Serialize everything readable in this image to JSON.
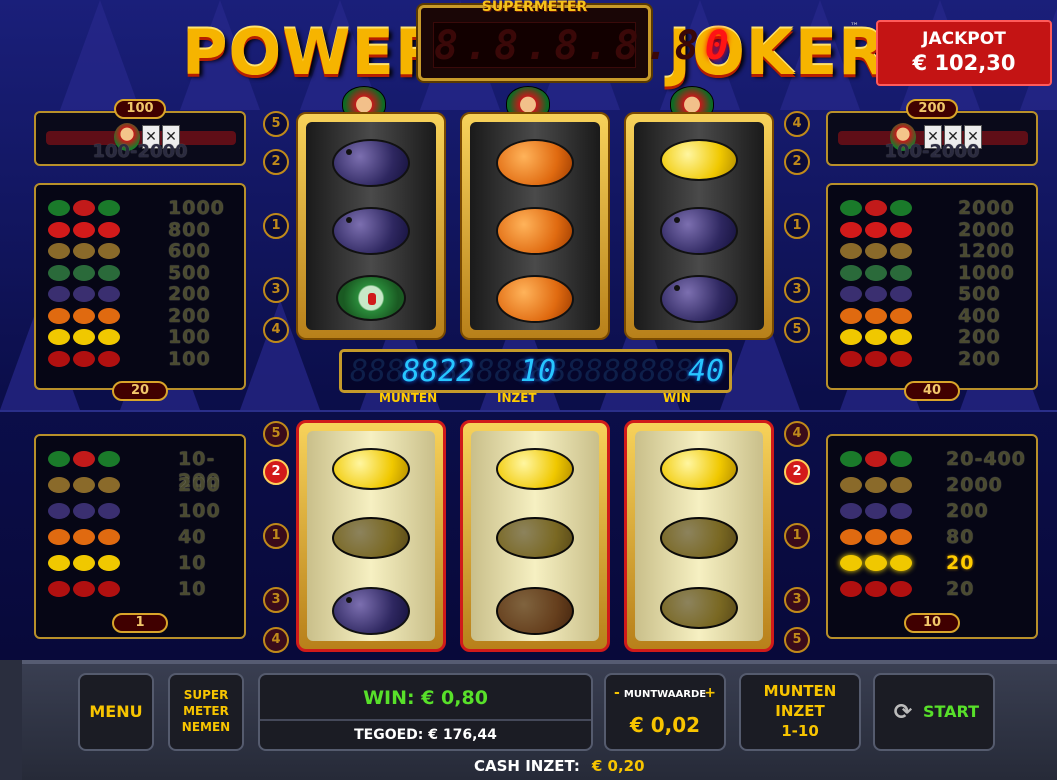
{
  "title": {
    "left": "POWER",
    "right": "JOKER",
    "tm": "™"
  },
  "supermeter": {
    "label": "SUPERMETER",
    "ghost": "8.8.8.8.8",
    "value": "0"
  },
  "jackpot": {
    "label": "JACKPOT",
    "amount": "€ 102,30"
  },
  "left_panel": {
    "top_badge": "100",
    "top_range": "100-2000",
    "rows": [
      {
        "sym": "jokers",
        "value": "1000"
      },
      {
        "sym": "sevens",
        "value": "800"
      },
      {
        "sym": "bells",
        "value": "600"
      },
      {
        "sym": "melons",
        "value": "500"
      },
      {
        "sym": "plums",
        "value": "200"
      },
      {
        "sym": "oranges",
        "value": "200"
      },
      {
        "sym": "lemons",
        "value": "100"
      },
      {
        "sym": "cherries",
        "value": "100"
      }
    ],
    "bottom_badge": "20"
  },
  "right_panel": {
    "top_badge": "200",
    "top_range": "100-2000",
    "rows": [
      {
        "sym": "jokers",
        "value": "2000"
      },
      {
        "sym": "sevens",
        "value": "2000"
      },
      {
        "sym": "bells",
        "value": "1200"
      },
      {
        "sym": "melons",
        "value": "1000"
      },
      {
        "sym": "plums",
        "value": "500"
      },
      {
        "sym": "oranges",
        "value": "400"
      },
      {
        "sym": "lemons",
        "value": "200"
      },
      {
        "sym": "cherries",
        "value": "200"
      }
    ],
    "bottom_badge": "40"
  },
  "left_lower_panel": {
    "rows": [
      {
        "sym": "jokers",
        "value": "10-200"
      },
      {
        "sym": "bells",
        "value": "200"
      },
      {
        "sym": "plums",
        "value": "100"
      },
      {
        "sym": "oranges",
        "value": "40"
      },
      {
        "sym": "lemons",
        "value": "10"
      },
      {
        "sym": "cherries",
        "value": "10"
      }
    ],
    "bottom_badge": "1"
  },
  "right_lower_panel": {
    "rows": [
      {
        "sym": "jokers",
        "value": "20-400"
      },
      {
        "sym": "bells",
        "value": "2000"
      },
      {
        "sym": "plums",
        "value": "200"
      },
      {
        "sym": "oranges",
        "value": "80"
      },
      {
        "sym": "lemons",
        "value": "20",
        "highlight": true
      },
      {
        "sym": "cherries",
        "value": "20"
      }
    ],
    "bottom_badge": "10"
  },
  "top_reels": [
    [
      "plum",
      "plum",
      "melon"
    ],
    [
      "orange",
      "orange",
      "orange"
    ],
    [
      "lemon",
      "plum",
      "plum"
    ]
  ],
  "bottom_reels": [
    [
      "lemon",
      "lemon-dim",
      "plum"
    ],
    [
      "lemon",
      "lemon-dim",
      "orange-dim"
    ],
    [
      "lemon",
      "lemon-dim",
      "lemon-dim"
    ]
  ],
  "line_numbers": {
    "top_left": [
      "5",
      "2",
      "1",
      "3",
      "4"
    ],
    "top_right": [
      "4",
      "2",
      "1",
      "3",
      "5"
    ],
    "bottom_left": [
      "5",
      "2",
      "1",
      "3",
      "4"
    ],
    "bottom_right": [
      "4",
      "2",
      "1",
      "3",
      "5"
    ],
    "active": "2"
  },
  "counter": {
    "ghost": "8888888888888888888",
    "munten": "8822",
    "inzet": "10",
    "win": "40",
    "munten_label": "MUNTEN",
    "inzet_label": "INZET",
    "win_label": "WIN"
  },
  "bottom_bar": {
    "menu": "MENU",
    "super_meter_lines": [
      "SUPER",
      "METER",
      "NEMEN"
    ],
    "win_text": "WIN: € 0,80",
    "tegoed_text": "TEGOED: € 176,44",
    "muntwaarde_label": "MUNTWAARDE",
    "muntwaarde_minus": "-",
    "muntwaarde_plus": "+",
    "muntwaarde_value": "€ 0,02",
    "munten_inzet_lines": [
      "MUNTEN",
      "INZET",
      "1-10"
    ],
    "start": "START",
    "cash_inzet_label": "CASH INZET:",
    "cash_inzet_value": "€ 0,20"
  },
  "colors": {
    "accent_gold": "#f7c400",
    "win_green": "#58e02a",
    "jackpot_red": "#c41414",
    "display_blue": "#27c6ff"
  }
}
